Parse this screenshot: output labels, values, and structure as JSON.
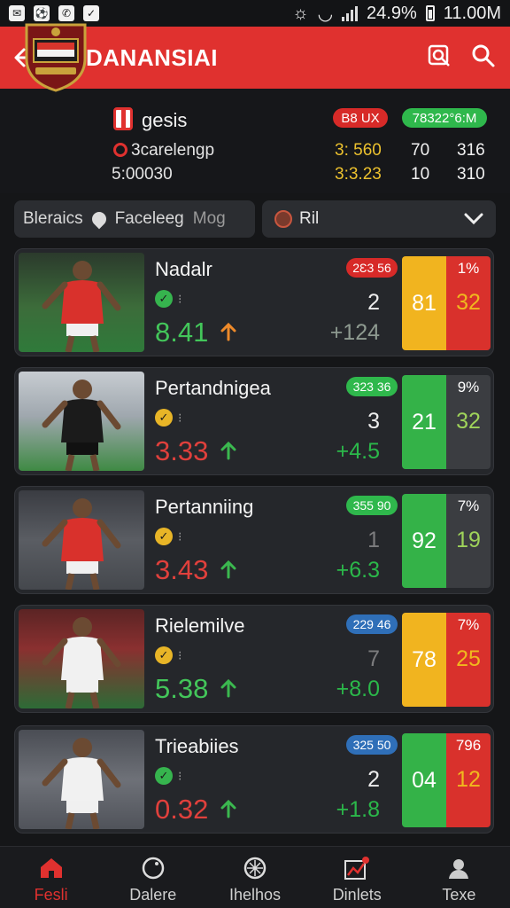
{
  "status_bar": {
    "battery": "24.9%",
    "time": "11.00M"
  },
  "app_bar": {
    "title": "INDANANSIAI"
  },
  "team": {
    "name": "gesis",
    "subtitle": "3carelengp",
    "score_line": "5:00030",
    "pill_left": "B8 UX",
    "pill_right": "78322°6:M",
    "stats": [
      {
        "label": "3: 560",
        "a": "70",
        "b": "316"
      },
      {
        "label": "3:3.23",
        "a": "10",
        "b": "310"
      }
    ]
  },
  "filters": {
    "items": [
      "Bleraics",
      "Faceleeg",
      "Mog"
    ],
    "dropdown_label": "Ril"
  },
  "players": [
    {
      "name": "Nadalr",
      "badge": "check",
      "rating": "8.41",
      "rating_color": "green",
      "rank": "2",
      "delta": "+124",
      "tag": "2Ɛ3 56",
      "tag_color": "red",
      "left_val": "81",
      "left_color": "orange",
      "pct": "1%",
      "right_val": "32",
      "right_color": "red"
    },
    {
      "name": "Pertandnigea",
      "badge": "check",
      "rating": "3.33",
      "rating_color": "red",
      "rank": "3",
      "delta": "+4.5",
      "tag": "323 36",
      "tag_color": "green",
      "left_val": "21",
      "left_color": "green",
      "pct": "9%",
      "right_val": "32",
      "right_color": "gray"
    },
    {
      "name": "Pertanniing",
      "badge": "check",
      "rating": "3.43",
      "rating_color": "red",
      "rank": "1",
      "delta": "+6.3",
      "tag": "355 90",
      "tag_color": "green",
      "left_val": "92",
      "left_color": "green",
      "pct": "7%",
      "right_val": "19",
      "right_color": "gray"
    },
    {
      "name": "Rielemilve",
      "badge": "check",
      "rating": "5.38",
      "rating_color": "green",
      "rank": "7",
      "delta": "+8.0",
      "tag": "229 46",
      "tag_color": "blue",
      "left_val": "78",
      "left_color": "orange",
      "pct": "7%",
      "right_val": "25",
      "right_color": "red"
    },
    {
      "name": "Trieabiies",
      "badge": "check",
      "rating": "0.32",
      "rating_color": "red",
      "rank": "2",
      "delta": "+1.8",
      "tag": "325 50",
      "tag_color": "blue",
      "left_val": "04",
      "left_color": "green",
      "pct": "796",
      "right_val": "12",
      "right_color": "red"
    }
  ],
  "bottom_nav": [
    {
      "label": "Fesli",
      "icon": "home-icon",
      "active": true
    },
    {
      "label": "Dalere",
      "icon": "clock-icon",
      "active": false
    },
    {
      "label": "Ihelhos",
      "icon": "ball-icon",
      "active": false
    },
    {
      "label": "Dinlets",
      "icon": "chart-icon",
      "active": false
    },
    {
      "label": "Texe",
      "icon": "profile-icon",
      "active": false
    }
  ]
}
